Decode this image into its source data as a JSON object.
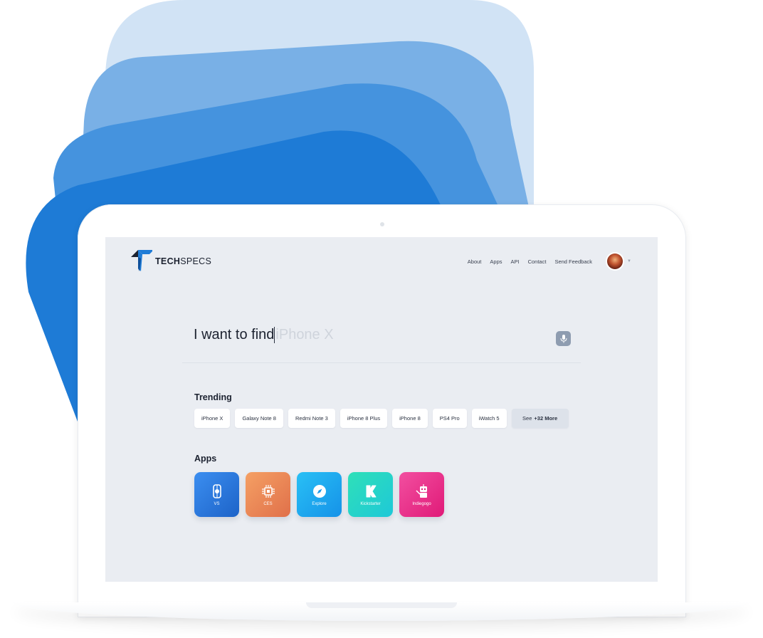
{
  "brand": {
    "logo_bold": "TECH",
    "logo_light": "SPECS"
  },
  "nav": {
    "items": [
      "About",
      "Apps",
      "API",
      "Contact",
      "Send Feedback"
    ]
  },
  "search": {
    "prefix": "I want to find",
    "placeholder": "iPhone X"
  },
  "trending": {
    "title": "Trending",
    "chips": [
      "iPhone X",
      "Galaxy Note 8",
      "Redmi Note 3",
      "iPhone 8 Plus",
      "iPhone 8",
      "PS4 Pro",
      "iWatch 5"
    ],
    "more_prefix": "See",
    "more_count": "+32 More"
  },
  "apps": {
    "title": "Apps",
    "items": [
      {
        "label": "VS",
        "icon": "versus-icon",
        "color_from": "#3b8ef0",
        "color_to": "#1d63c8"
      },
      {
        "label": "CES",
        "icon": "chip-icon",
        "color_from": "#f5a064",
        "color_to": "#e0704a"
      },
      {
        "label": "Explore",
        "icon": "compass-icon",
        "color_from": "#29c0f5",
        "color_to": "#1592e8"
      },
      {
        "label": "Kickstarter",
        "icon": "kickstarter-icon",
        "color_from": "#2fe0b8",
        "color_to": "#1ec8d8"
      },
      {
        "label": "Indiegogo",
        "icon": "robot-icon",
        "color_from": "#f24fa0",
        "color_to": "#e01a78"
      }
    ]
  },
  "colors": {
    "accent": "#1e7bd6",
    "screen_bg": "#eaedf2"
  }
}
